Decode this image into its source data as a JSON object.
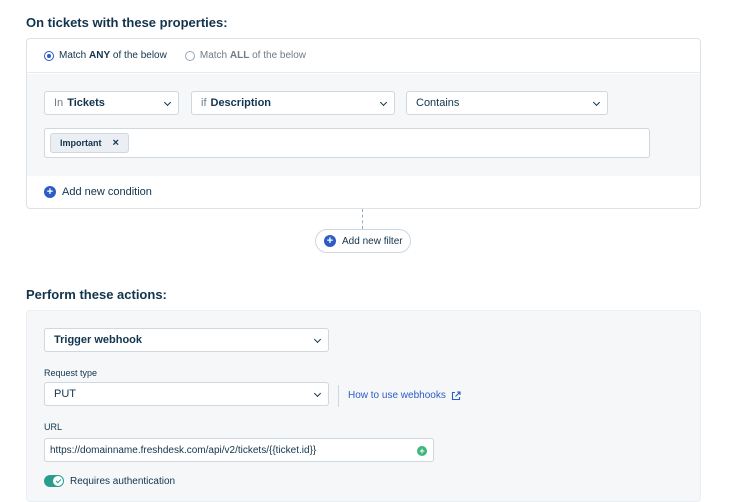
{
  "conditions": {
    "title": "On tickets with these properties:",
    "match_any": {
      "prefix": "Match ",
      "bold": "ANY",
      "suffix": " of the below",
      "selected": true
    },
    "match_all": {
      "prefix": "Match ",
      "bold": "ALL",
      "suffix": " of the below",
      "selected": false
    },
    "row": {
      "scope": {
        "prefix": "In",
        "value": "Tickets"
      },
      "field": {
        "prefix": "if",
        "value": "Description"
      },
      "operator": {
        "value": "Contains"
      }
    },
    "tags": [
      "Important"
    ],
    "tag_remove": "×",
    "add_condition_label": "Add new condition",
    "plus_glyph": "+"
  },
  "filter": {
    "add_filter_label": "Add new filter"
  },
  "actions": {
    "title": "Perform these actions:",
    "action_type": "Trigger webhook",
    "request_type_label": "Request type",
    "request_type_value": "PUT",
    "help_link": "How to use webhooks",
    "url_label": "URL",
    "url_value": "https://domainname.freshdesk.com/api/v2/tickets/{{ticket.id}}",
    "auth_label": "Requires authentication",
    "auth_enabled": true
  },
  "colors": {
    "accent": "#2c5cc5",
    "toggle_on": "#2a9d8f",
    "insert_placeholder": "#3bb77e"
  }
}
